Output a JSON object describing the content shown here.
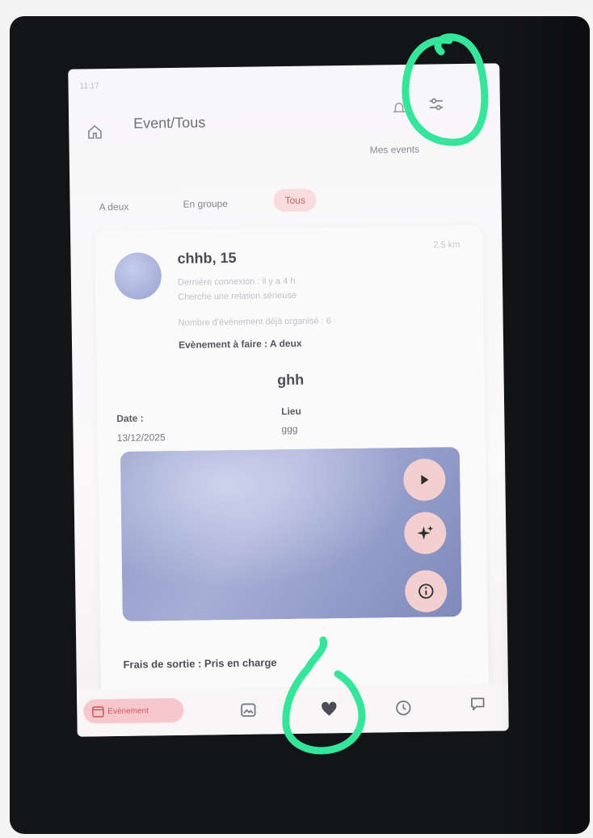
{
  "status_bar": {
    "time": "11:17"
  },
  "header": {
    "title": "Event/Tous",
    "my_events_link": "Mes events"
  },
  "tabs": [
    {
      "label": "A deux"
    },
    {
      "label": "En groupe"
    },
    {
      "label": "Tous",
      "selected": true
    }
  ],
  "event_card": {
    "name_age": "chhb, 15",
    "distance": "2.5 km",
    "last_connection": "Dernière connexion : il y a 4 h",
    "looking_for": "Cherche une relation sérieuse",
    "events_organized": "Nombre d'évènement déjà organisé : 6",
    "event_type": "Evènement à faire : A deux",
    "event_name": "ghh",
    "date_label": "Date :",
    "date_value": "13/12/2025",
    "place_label": "Lieu",
    "place_value": "ggg",
    "exit_fees": "Frais de sortie : Pris en charge"
  },
  "bottom_nav": {
    "events_label": "Evènement"
  },
  "icons": {
    "home": "home-icon",
    "bell": "bell-icon",
    "filter": "filter-sliders-icon",
    "play": "play-icon",
    "sparkle": "sparkle-icon",
    "info": "info-icon",
    "calendar": "calendar-icon",
    "gallery": "gallery-icon",
    "heart": "heart-icon",
    "history": "clock-icon",
    "chat": "chat-bubble-icon"
  },
  "colors": {
    "accent_pink": "#f9dcdd",
    "accent_text": "#d05c63",
    "annotation_green": "#34e59a"
  }
}
